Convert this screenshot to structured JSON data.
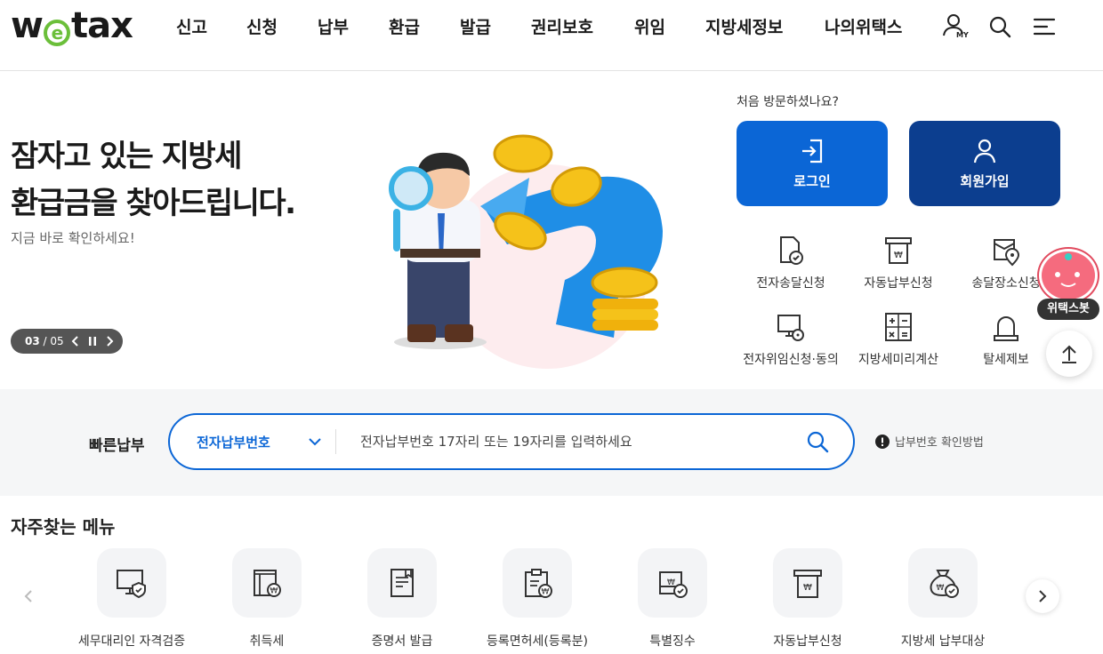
{
  "header": {
    "logo": "wetax",
    "nav": [
      "신고",
      "신청",
      "납부",
      "환급",
      "발급",
      "권리보호",
      "위임",
      "지방세정보",
      "나의위택스"
    ],
    "my_label": "MY"
  },
  "hero": {
    "title_line1": "잠자고 있는 지방세",
    "title_line2": "환급금을 찾아드립니다.",
    "subtitle": "지금 바로 확인하세요!",
    "slide_current": "03",
    "slide_total": "05"
  },
  "account": {
    "question": "처음 방문하셨나요?",
    "login": "로그인",
    "signup": "회원가입"
  },
  "services": [
    {
      "label": "전자송달신청",
      "icon": "doc-check-icon"
    },
    {
      "label": "자동납부신청",
      "icon": "auto-pay-icon"
    },
    {
      "label": "송달장소신청",
      "icon": "location-doc-icon"
    },
    {
      "label": "전자위임신청·동의",
      "icon": "monitor-lock-icon"
    },
    {
      "label": "지방세미리계산",
      "icon": "calculator-icon"
    },
    {
      "label": "탈세제보",
      "icon": "siren-icon"
    }
  ],
  "floating": {
    "bot_label": "위택스봇"
  },
  "quick_pay": {
    "label": "빠른납부",
    "select_value": "전자납부번호",
    "placeholder": "전자납부번호 17자리 또는 19자리를 입력하세요",
    "help": "납부번호 확인방법"
  },
  "favorites": {
    "title": "자주찾는 메뉴",
    "items": [
      {
        "label": "세무대리인 자격검증",
        "icon": "monitor-shield-icon"
      },
      {
        "label": "취득세",
        "icon": "building-won-icon"
      },
      {
        "label": "증명서 발급",
        "icon": "certificate-icon"
      },
      {
        "label": "등록면허세(등록분)",
        "icon": "clipboard-won-icon"
      },
      {
        "label": "특별징수",
        "icon": "envelope-won-icon"
      },
      {
        "label": "자동납부신청",
        "icon": "auto-pay-icon"
      },
      {
        "label": "지방세 납부대상",
        "icon": "money-bag-icon"
      }
    ]
  },
  "colors": {
    "primary": "#0b66d6",
    "navy": "#0c3e8f",
    "logo_green": "#6bbf3a",
    "bot_pink": "#f56b7e"
  }
}
